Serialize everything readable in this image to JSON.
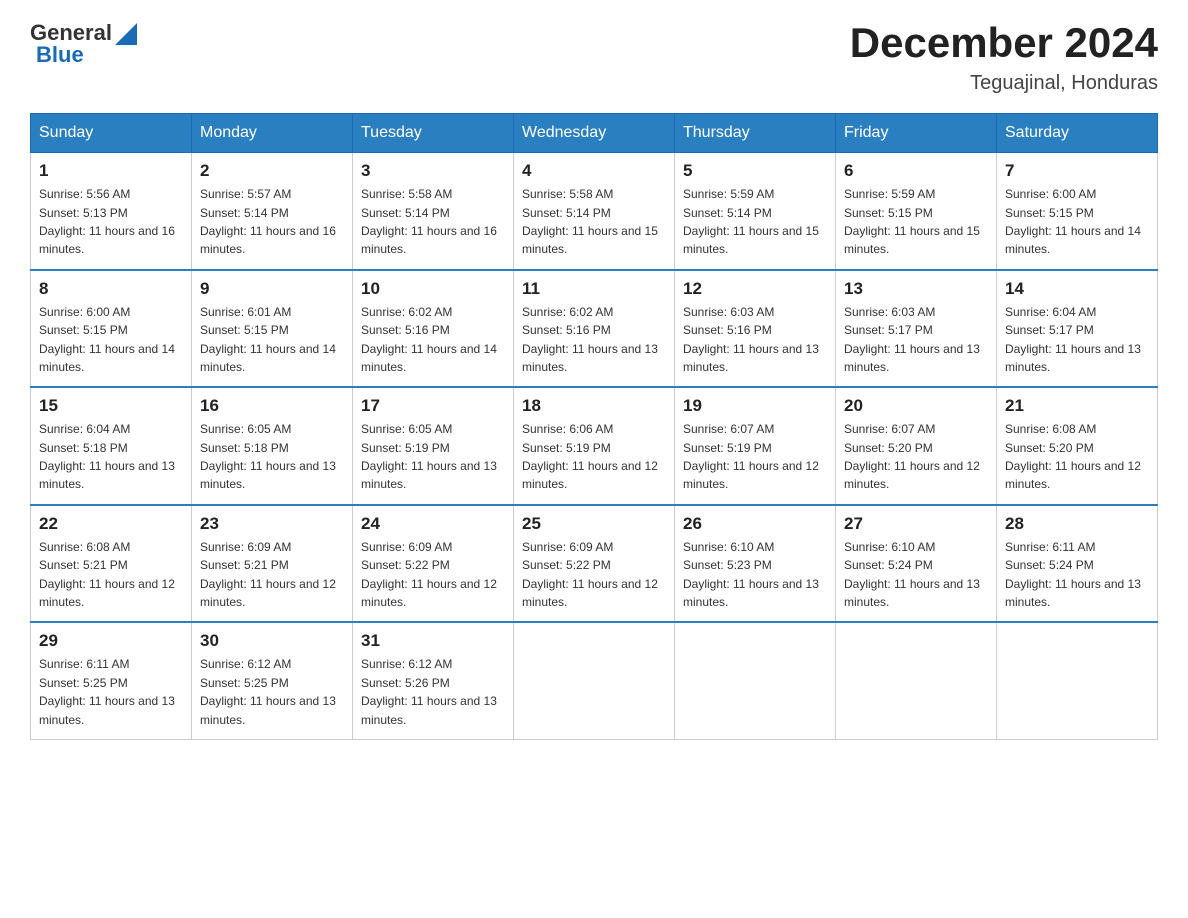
{
  "logo": {
    "general": "General",
    "blue": "Blue"
  },
  "title": {
    "month_year": "December 2024",
    "location": "Teguajinal, Honduras"
  },
  "headers": [
    "Sunday",
    "Monday",
    "Tuesday",
    "Wednesday",
    "Thursday",
    "Friday",
    "Saturday"
  ],
  "weeks": [
    [
      {
        "day": "1",
        "sunrise": "5:56 AM",
        "sunset": "5:13 PM",
        "daylight": "11 hours and 16 minutes."
      },
      {
        "day": "2",
        "sunrise": "5:57 AM",
        "sunset": "5:14 PM",
        "daylight": "11 hours and 16 minutes."
      },
      {
        "day": "3",
        "sunrise": "5:58 AM",
        "sunset": "5:14 PM",
        "daylight": "11 hours and 16 minutes."
      },
      {
        "day": "4",
        "sunrise": "5:58 AM",
        "sunset": "5:14 PM",
        "daylight": "11 hours and 15 minutes."
      },
      {
        "day": "5",
        "sunrise": "5:59 AM",
        "sunset": "5:14 PM",
        "daylight": "11 hours and 15 minutes."
      },
      {
        "day": "6",
        "sunrise": "5:59 AM",
        "sunset": "5:15 PM",
        "daylight": "11 hours and 15 minutes."
      },
      {
        "day": "7",
        "sunrise": "6:00 AM",
        "sunset": "5:15 PM",
        "daylight": "11 hours and 14 minutes."
      }
    ],
    [
      {
        "day": "8",
        "sunrise": "6:00 AM",
        "sunset": "5:15 PM",
        "daylight": "11 hours and 14 minutes."
      },
      {
        "day": "9",
        "sunrise": "6:01 AM",
        "sunset": "5:15 PM",
        "daylight": "11 hours and 14 minutes."
      },
      {
        "day": "10",
        "sunrise": "6:02 AM",
        "sunset": "5:16 PM",
        "daylight": "11 hours and 14 minutes."
      },
      {
        "day": "11",
        "sunrise": "6:02 AM",
        "sunset": "5:16 PM",
        "daylight": "11 hours and 13 minutes."
      },
      {
        "day": "12",
        "sunrise": "6:03 AM",
        "sunset": "5:16 PM",
        "daylight": "11 hours and 13 minutes."
      },
      {
        "day": "13",
        "sunrise": "6:03 AM",
        "sunset": "5:17 PM",
        "daylight": "11 hours and 13 minutes."
      },
      {
        "day": "14",
        "sunrise": "6:04 AM",
        "sunset": "5:17 PM",
        "daylight": "11 hours and 13 minutes."
      }
    ],
    [
      {
        "day": "15",
        "sunrise": "6:04 AM",
        "sunset": "5:18 PM",
        "daylight": "11 hours and 13 minutes."
      },
      {
        "day": "16",
        "sunrise": "6:05 AM",
        "sunset": "5:18 PM",
        "daylight": "11 hours and 13 minutes."
      },
      {
        "day": "17",
        "sunrise": "6:05 AM",
        "sunset": "5:19 PM",
        "daylight": "11 hours and 13 minutes."
      },
      {
        "day": "18",
        "sunrise": "6:06 AM",
        "sunset": "5:19 PM",
        "daylight": "11 hours and 12 minutes."
      },
      {
        "day": "19",
        "sunrise": "6:07 AM",
        "sunset": "5:19 PM",
        "daylight": "11 hours and 12 minutes."
      },
      {
        "day": "20",
        "sunrise": "6:07 AM",
        "sunset": "5:20 PM",
        "daylight": "11 hours and 12 minutes."
      },
      {
        "day": "21",
        "sunrise": "6:08 AM",
        "sunset": "5:20 PM",
        "daylight": "11 hours and 12 minutes."
      }
    ],
    [
      {
        "day": "22",
        "sunrise": "6:08 AM",
        "sunset": "5:21 PM",
        "daylight": "11 hours and 12 minutes."
      },
      {
        "day": "23",
        "sunrise": "6:09 AM",
        "sunset": "5:21 PM",
        "daylight": "11 hours and 12 minutes."
      },
      {
        "day": "24",
        "sunrise": "6:09 AM",
        "sunset": "5:22 PM",
        "daylight": "11 hours and 12 minutes."
      },
      {
        "day": "25",
        "sunrise": "6:09 AM",
        "sunset": "5:22 PM",
        "daylight": "11 hours and 12 minutes."
      },
      {
        "day": "26",
        "sunrise": "6:10 AM",
        "sunset": "5:23 PM",
        "daylight": "11 hours and 13 minutes."
      },
      {
        "day": "27",
        "sunrise": "6:10 AM",
        "sunset": "5:24 PM",
        "daylight": "11 hours and 13 minutes."
      },
      {
        "day": "28",
        "sunrise": "6:11 AM",
        "sunset": "5:24 PM",
        "daylight": "11 hours and 13 minutes."
      }
    ],
    [
      {
        "day": "29",
        "sunrise": "6:11 AM",
        "sunset": "5:25 PM",
        "daylight": "11 hours and 13 minutes."
      },
      {
        "day": "30",
        "sunrise": "6:12 AM",
        "sunset": "5:25 PM",
        "daylight": "11 hours and 13 minutes."
      },
      {
        "day": "31",
        "sunrise": "6:12 AM",
        "sunset": "5:26 PM",
        "daylight": "11 hours and 13 minutes."
      },
      null,
      null,
      null,
      null
    ]
  ]
}
